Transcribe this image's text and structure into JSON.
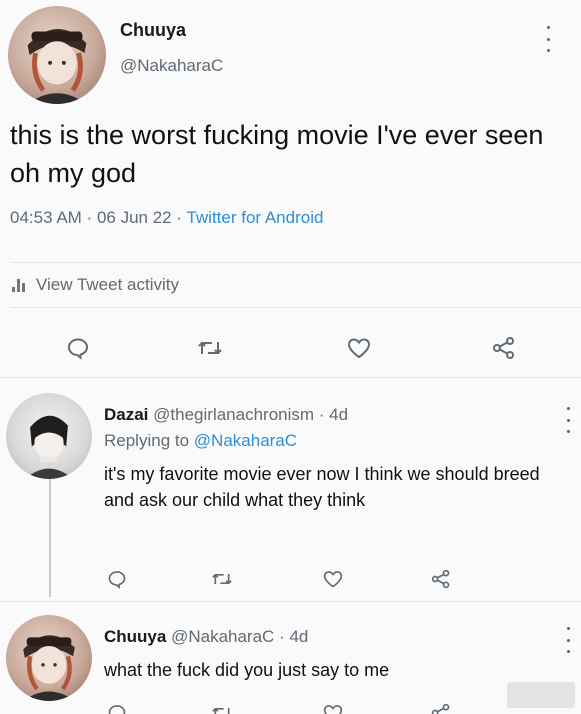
{
  "main_tweet": {
    "display_name": "Chuuya",
    "handle": "@NakaharaC",
    "text": "this is the worst fucking movie I've ever seen oh my god",
    "time": "04:53 AM",
    "date": "06 Jun 22",
    "source": "Twitter for Android",
    "separator": " · ",
    "activity_label": "View Tweet activity",
    "actions": [
      "reply-icon",
      "retweet-icon",
      "like-icon",
      "share-icon"
    ]
  },
  "replies": [
    {
      "display_name": "Dazai",
      "handle": "@thegirlanachronism",
      "age": "4d",
      "replying_label": "Replying to",
      "replying_handle": "@NakaharaC",
      "text": "it's my favorite movie ever now I think we should breed and ask our child what they think"
    },
    {
      "display_name": "Chuuya",
      "handle": "@NakaharaC",
      "age": "4d",
      "text": "what the fuck did you just say to me"
    }
  ],
  "colors": {
    "link_blue": "#2c8ed6",
    "muted_gray": "#5f6b75",
    "background": "#fafafa"
  }
}
